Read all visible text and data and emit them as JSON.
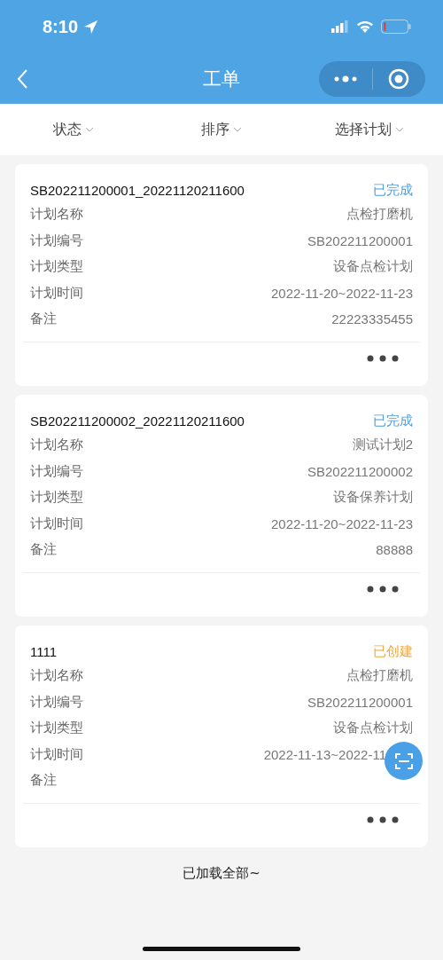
{
  "status_bar": {
    "time": "8:10"
  },
  "nav": {
    "title": "工单"
  },
  "filters": [
    {
      "label": "状态"
    },
    {
      "label": "排序"
    },
    {
      "label": "选择计划"
    }
  ],
  "cards": [
    {
      "title": "SB202211200001_20221120211600",
      "status": "已完成",
      "color": "#4a9ee0",
      "fields": [
        {
          "label": "计划名称",
          "value": "点检打磨机"
        },
        {
          "label": "计划编号",
          "value": "SB202211200001"
        },
        {
          "label": "计划类型",
          "value": "设备点检计划"
        },
        {
          "label": "计划时间",
          "value": "2022-11-20~2022-11-23"
        },
        {
          "label": "备注",
          "value": "22223335455"
        }
      ]
    },
    {
      "title": "SB202211200002_20221120211600",
      "status": "已完成",
      "color": "#4a9ee0",
      "fields": [
        {
          "label": "计划名称",
          "value": "测试计划2"
        },
        {
          "label": "计划编号",
          "value": "SB202211200002"
        },
        {
          "label": "计划类型",
          "value": "设备保养计划"
        },
        {
          "label": "计划时间",
          "value": "2022-11-20~2022-11-23"
        },
        {
          "label": "备注",
          "value": "88888"
        }
      ]
    },
    {
      "title": "1111",
      "status": "已创建",
      "color": "#efa83c",
      "fields": [
        {
          "label": "计划名称",
          "value": "点检打磨机"
        },
        {
          "label": "计划编号",
          "value": "SB202211200001"
        },
        {
          "label": "计划类型",
          "value": "设备点检计划"
        },
        {
          "label": "计划时间",
          "value": "2022-11-13~2022-11",
          "cut_off": true
        },
        {
          "label": "备注"
        }
      ]
    }
  ],
  "footer": "已加载全部~"
}
